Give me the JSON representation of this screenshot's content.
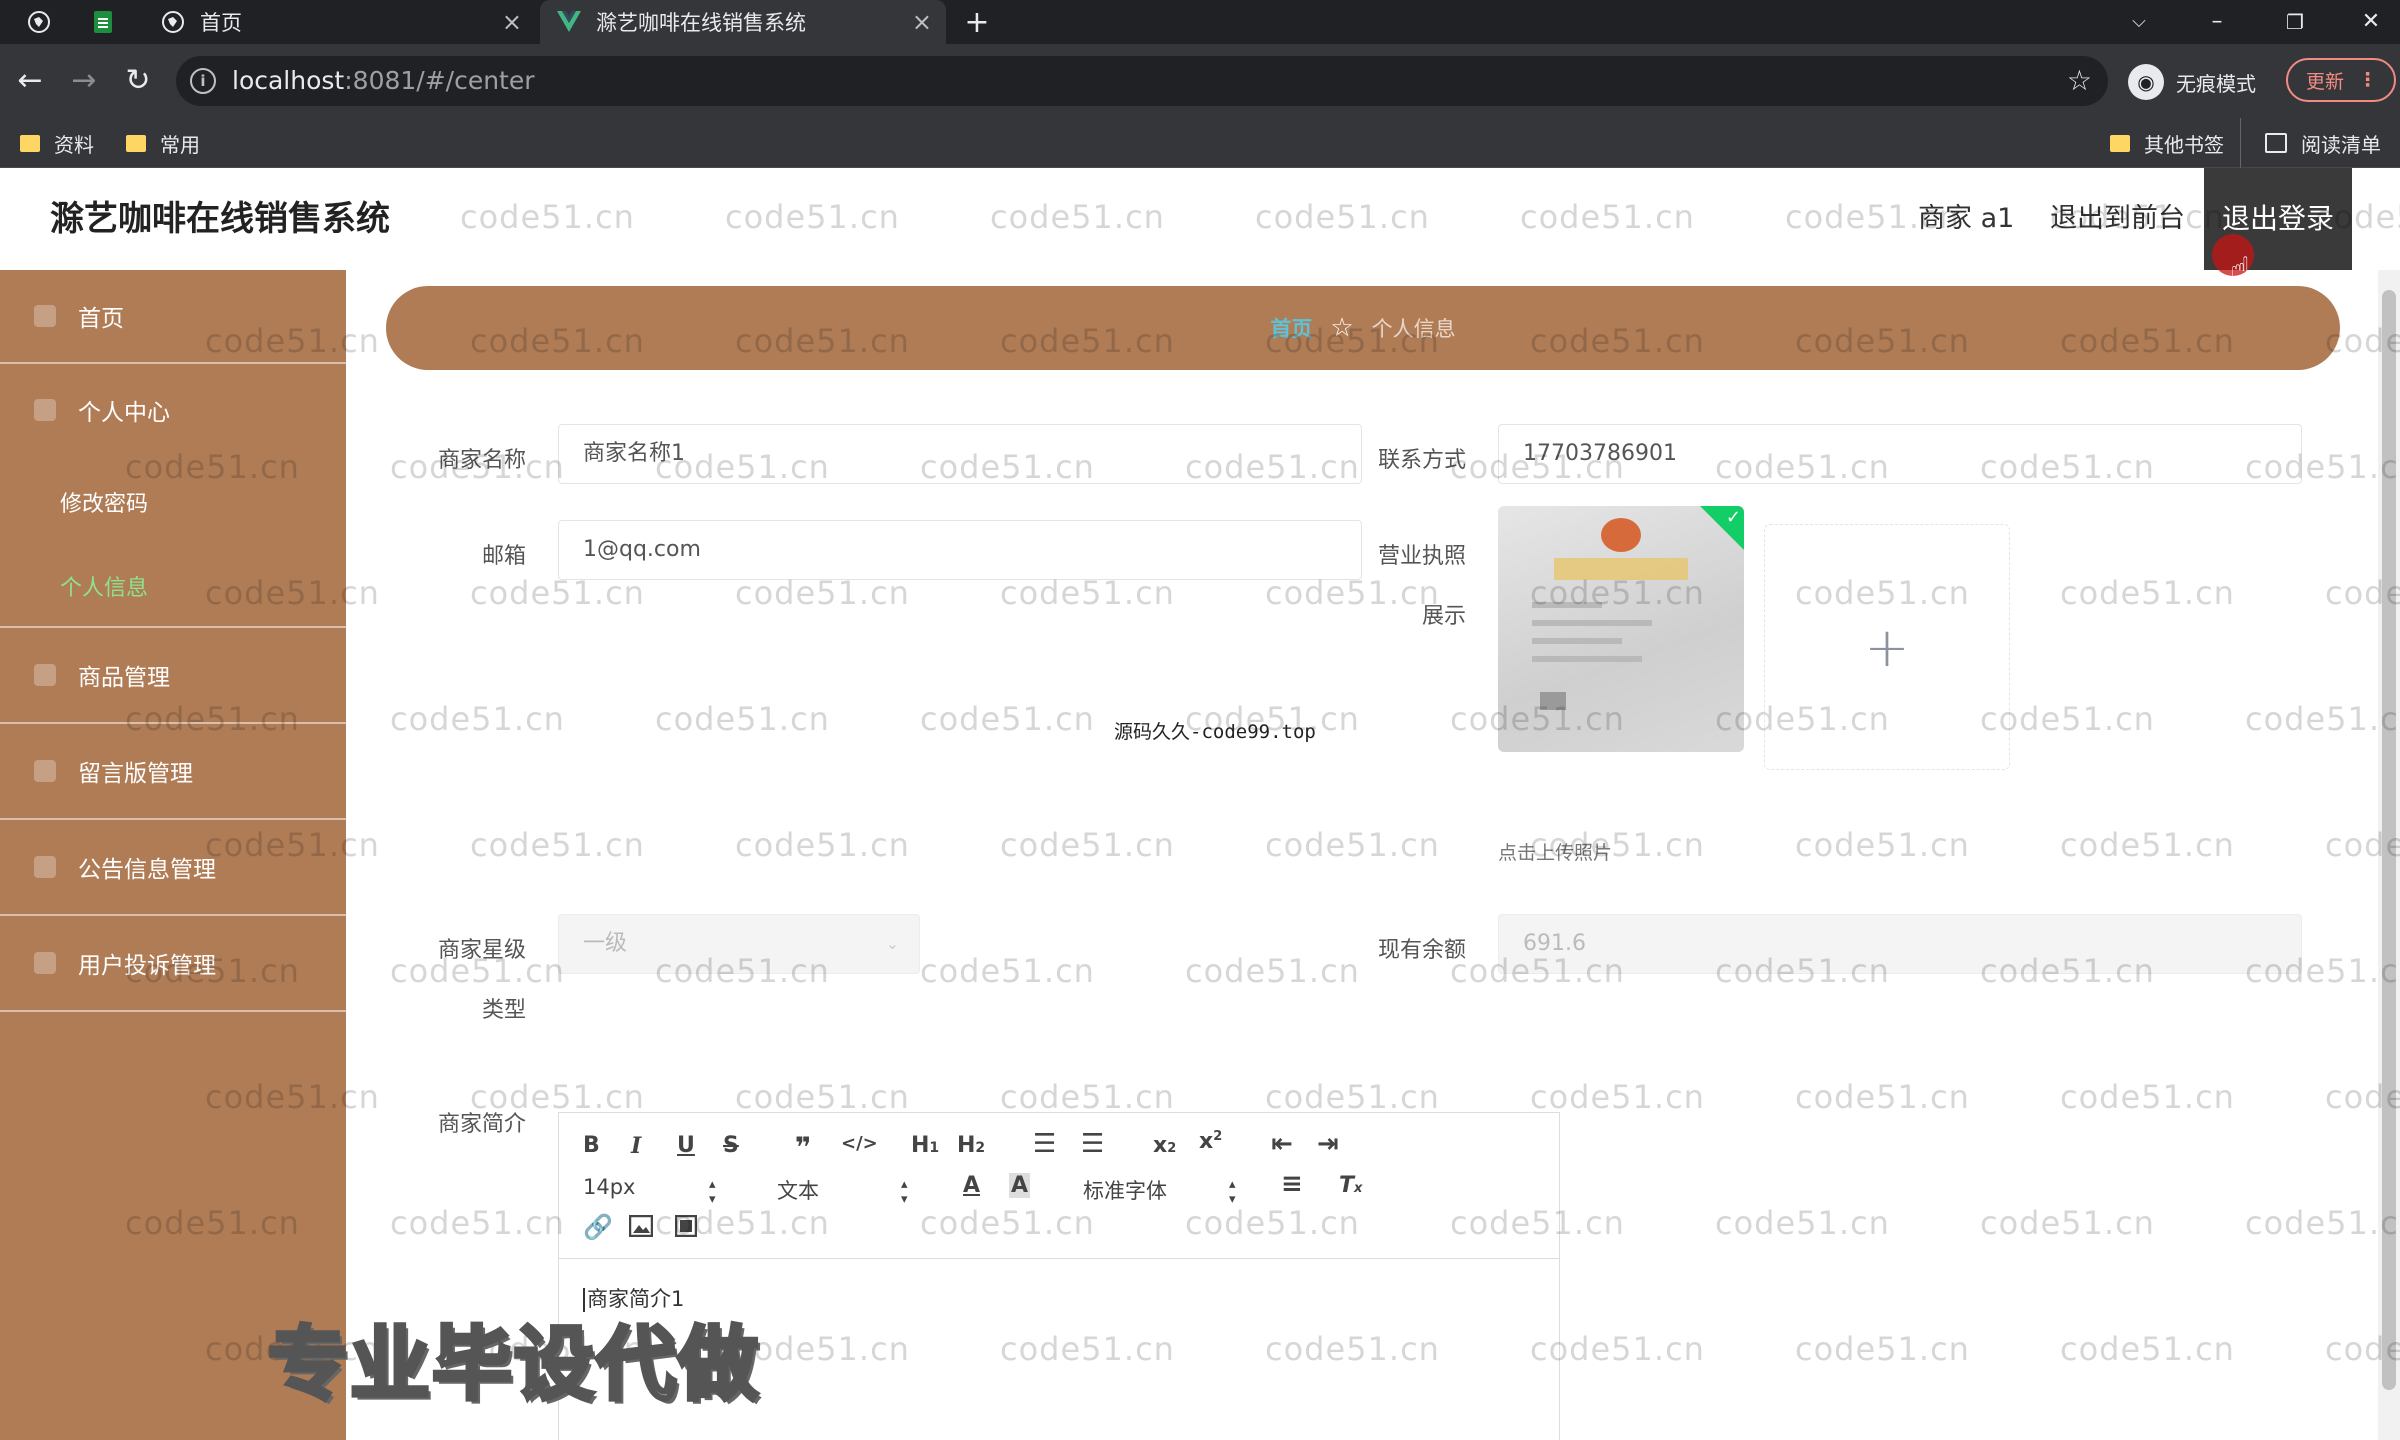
{
  "browser": {
    "tabs": [
      {
        "label": "首页"
      },
      {
        "label": "滁艺咖啡在线销售系统"
      }
    ],
    "url_host": "localhost",
    "url_path": ":8081/#/center",
    "incognito_label": "无痕模式",
    "update_label": "更新",
    "bookmarks": [
      {
        "label": "资料"
      },
      {
        "label": "常用"
      }
    ],
    "other_bookmarks": "其他书签",
    "reading_list": "阅读清单"
  },
  "header": {
    "title": "滁艺咖啡在线销售系统",
    "user": "商家 a1",
    "to_front": "退出到前台",
    "logout": "退出登录"
  },
  "sidebar": {
    "items": [
      {
        "label": "首页"
      },
      {
        "label": "个人中心"
      },
      {
        "label": "商品管理"
      },
      {
        "label": "留言版管理"
      },
      {
        "label": "公告信息管理"
      },
      {
        "label": "用户投诉管理"
      }
    ],
    "sub_items": [
      {
        "label": "修改密码"
      },
      {
        "label": "个人信息"
      }
    ]
  },
  "breadcrumb": {
    "home": "首页",
    "current": "个人信息"
  },
  "form": {
    "merchant_name_label": "商家名称",
    "merchant_name_value": "商家名称1",
    "contact_label": "联系方式",
    "contact_value": "17703786901",
    "email_label": "邮箱",
    "email_value": "1@qq.com",
    "license_label_line1": "营业执照",
    "license_label_line2": "展示",
    "upload_tip": "点击上传照片",
    "star_label_line1": "商家星级",
    "star_label_line2": "类型",
    "star_value": "一级",
    "balance_label": "现有余额",
    "balance_value": "691.6",
    "intro_label": "商家简介",
    "intro_value": "商家简介1"
  },
  "editor": {
    "font_size": "14px",
    "block_type": "文本",
    "font_family": "标准字体"
  },
  "overlays": {
    "watermark": "code51.cn",
    "center_watermark": "源码久久-code99.top",
    "banner": "专业毕设代做"
  }
}
